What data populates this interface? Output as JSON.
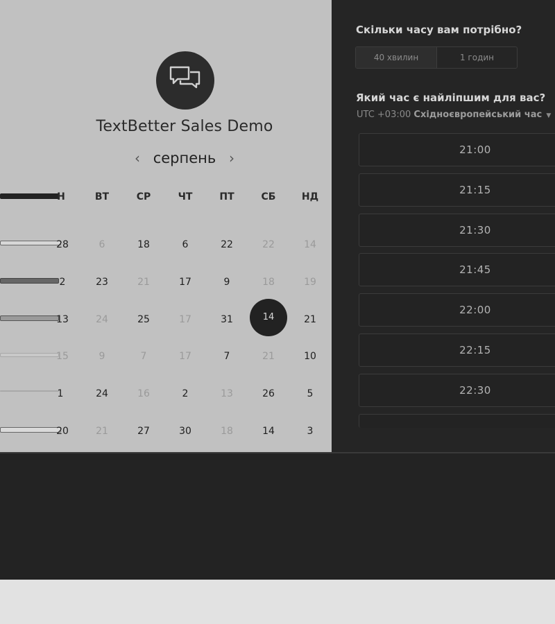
{
  "app": {
    "title": "TextBetter Sales Demo",
    "logo_icon": "chat-bubbles-icon"
  },
  "calendar": {
    "month": "серпень",
    "prev_icon": "chevron-left-icon",
    "next_icon": "chevron-right-icon",
    "weekdays": [
      "Н",
      "ВТ",
      "СР",
      "ЧТ",
      "ПТ",
      "СБ",
      "НД"
    ],
    "weeks": [
      [
        "28",
        "6",
        "18",
        "6",
        "22",
        "22",
        "14"
      ],
      [
        "2",
        "23",
        "21",
        "17",
        "9",
        "18",
        "19"
      ],
      [
        "13",
        "24",
        "25",
        "17",
        "31",
        "14",
        "21"
      ],
      [
        "15",
        "9",
        "7",
        "17",
        "7",
        "21",
        "10"
      ],
      [
        "1",
        "24",
        "16",
        "2",
        "13",
        "26",
        "5"
      ],
      [
        "20",
        "21",
        "27",
        "30",
        "18",
        "14",
        "3"
      ]
    ],
    "selected_day": "14"
  },
  "booking": {
    "duration_question": "Скільки часу вам потрібно?",
    "durations": [
      "40 хвилин",
      "1 годин"
    ],
    "selected_duration": "40 хвилин",
    "time_question": "Який час є найліпшим для вас?",
    "timezone_offset": "UTC +03:00",
    "timezone_name": "Східноєвропейський час",
    "time_slots": [
      "21:00",
      "21:15",
      "21:30",
      "21:45",
      "22:00",
      "22:15",
      "22:30"
    ]
  }
}
